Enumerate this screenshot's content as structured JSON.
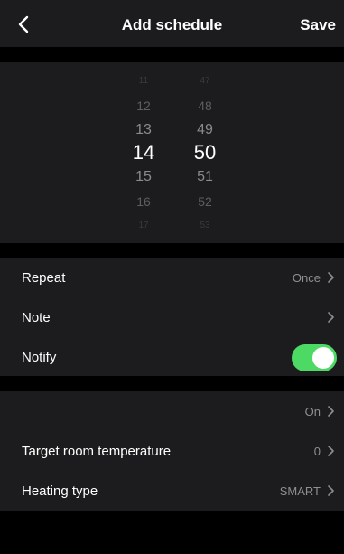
{
  "header": {
    "title": "Add schedule",
    "save_label": "Save"
  },
  "time_picker": {
    "hours": [
      "11",
      "12",
      "13",
      "14",
      "15",
      "16",
      "17"
    ],
    "minutes": [
      "47",
      "48",
      "49",
      "50",
      "51",
      "52",
      "53"
    ],
    "selected_hour": "14",
    "selected_minute": "50"
  },
  "settings": {
    "repeat": {
      "label": "Repeat",
      "value": "Once"
    },
    "note": {
      "label": "Note",
      "value": ""
    },
    "notify": {
      "label": "Notify",
      "enabled": true
    }
  },
  "heating": {
    "power": {
      "label": "",
      "value": "On"
    },
    "target_temp": {
      "label": "Target room temperature",
      "value": "0"
    },
    "heating_type": {
      "label": "Heating type",
      "value": "SMART"
    }
  },
  "colors": {
    "toggle_on": "#4cd964",
    "panel_bg": "#1c1c1e",
    "secondary_text": "#8e8e93"
  },
  "icons": {
    "back": "chevron-left-icon",
    "row_arrow": "chevron-right-icon"
  }
}
